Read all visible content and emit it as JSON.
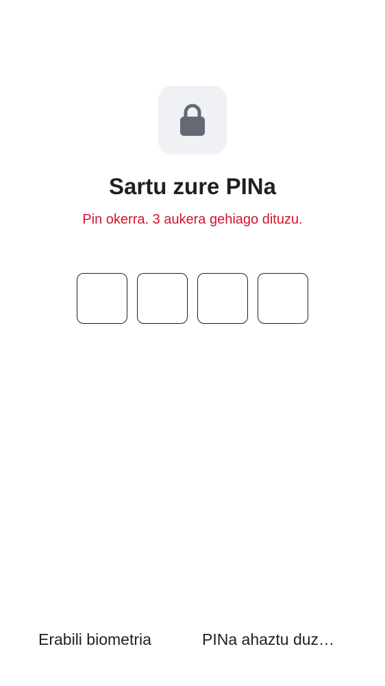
{
  "header": {
    "lock_icon": "lock-icon",
    "title": "Sartu zure PINa",
    "error_message": "Pin okerra. 3 aukera gehiago dituzu."
  },
  "pin": {
    "length": 4,
    "digits": [
      "",
      "",
      "",
      ""
    ]
  },
  "actions": {
    "biometrics_label": "Erabili biometria",
    "forgot_label": "PINa ahaztu duz…"
  },
  "colors": {
    "error": "#d0142c",
    "icon": "#636a74",
    "icon_tile": "#f0f1f5",
    "text": "#1f1f24"
  }
}
